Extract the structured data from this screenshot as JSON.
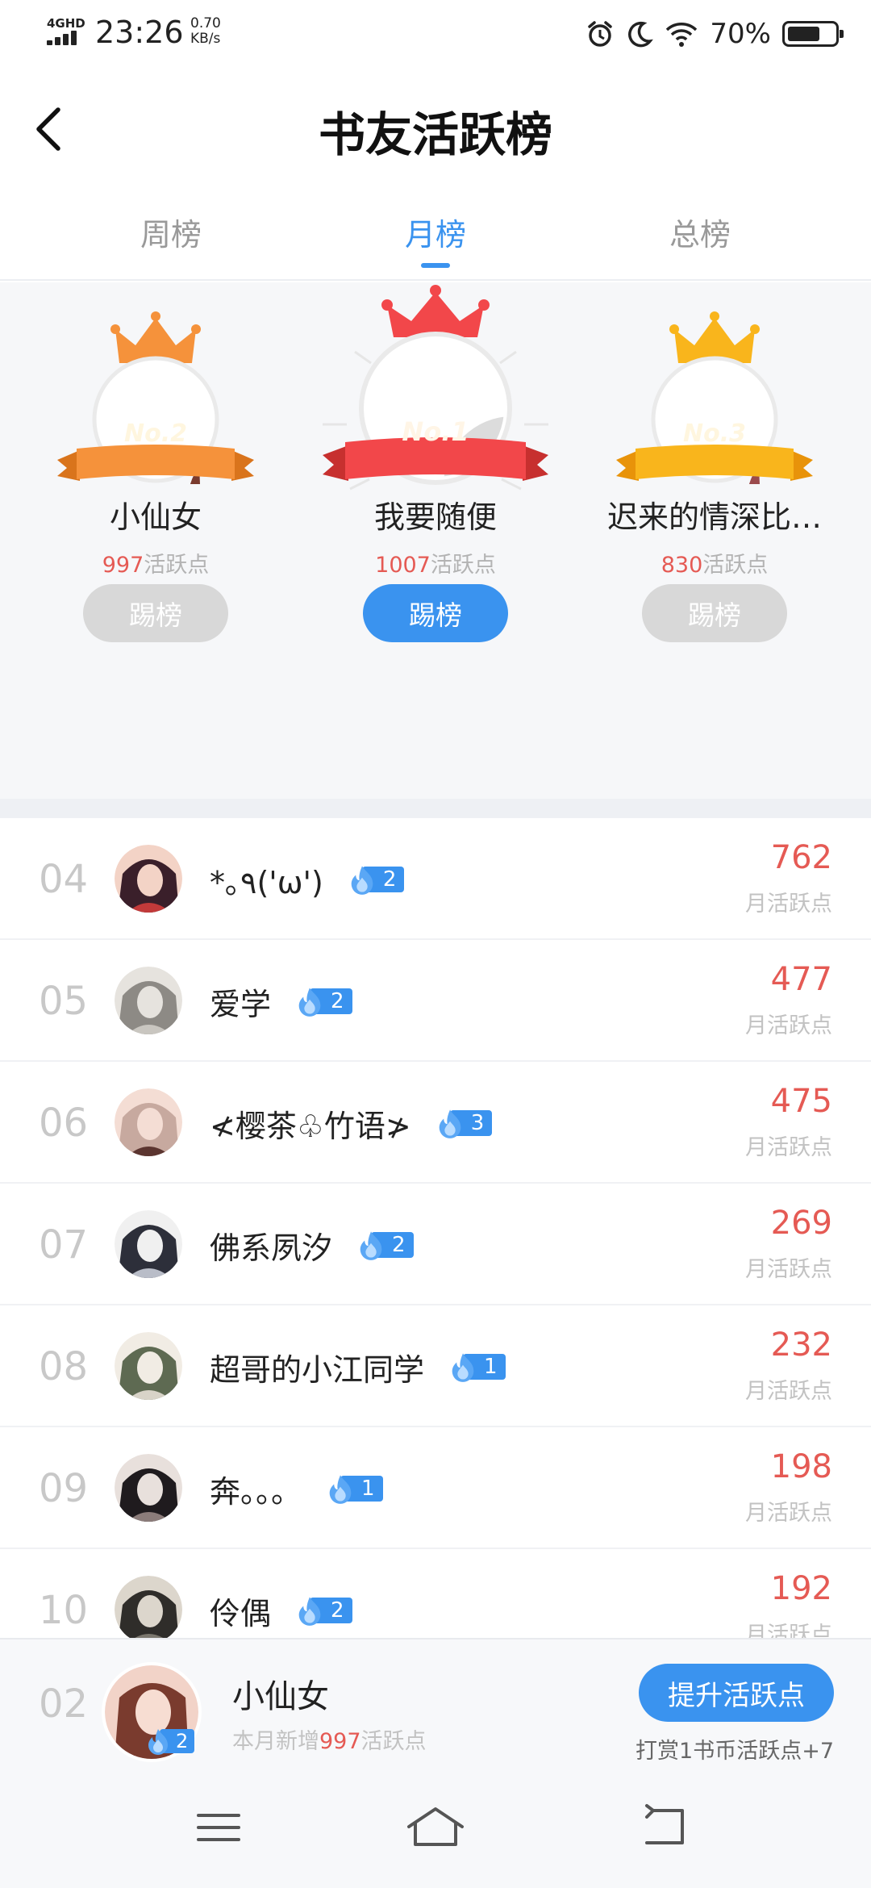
{
  "status_bar": {
    "network": "4GHD",
    "time": "23:26",
    "speed_value": "0.70",
    "speed_unit": "KB/s",
    "battery_text": "70%",
    "battery_level": 0.7
  },
  "header": {
    "title": "书友活跃榜"
  },
  "tabs": [
    {
      "label": "周榜",
      "active": false
    },
    {
      "label": "月榜",
      "active": true
    },
    {
      "label": "总榜",
      "active": false
    }
  ],
  "podium": {
    "second": {
      "badge": "No.2",
      "name": "小仙女",
      "points": "997",
      "points_suffix": "活跃点",
      "button": "踢榜",
      "crown_color": "#f5923b"
    },
    "first": {
      "badge": "No.1",
      "name": "我要随便",
      "points": "1007",
      "points_suffix": "活跃点",
      "button": "踢榜",
      "crown_color": "#f2474a"
    },
    "third": {
      "badge": "No.3",
      "name": "迟来的情深比…",
      "points": "830",
      "points_suffix": "活跃点",
      "button": "踢榜",
      "crown_color": "#f9b51c"
    }
  },
  "ranking": [
    {
      "rank": "04",
      "name": "*｡٩('ω')",
      "level": "2",
      "score": "762",
      "score_label": "月活跃点"
    },
    {
      "rank": "05",
      "name": "爱学",
      "level": "2",
      "score": "477",
      "score_label": "月活跃点"
    },
    {
      "rank": "06",
      "name": "≮樱茶♧竹语≯",
      "level": "3",
      "score": "475",
      "score_label": "月活跃点"
    },
    {
      "rank": "07",
      "name": "佛系夙汐",
      "level": "2",
      "score": "269",
      "score_label": "月活跃点"
    },
    {
      "rank": "08",
      "name": "超哥的小江同学",
      "level": "1",
      "score": "232",
      "score_label": "月活跃点"
    },
    {
      "rank": "09",
      "name": "奔。。。",
      "level": "1",
      "score": "198",
      "score_label": "月活跃点"
    },
    {
      "rank": "10",
      "name": "伶偶",
      "level": "2",
      "score": "192",
      "score_label": "月活跃点"
    }
  ],
  "self": {
    "rank": "02",
    "name": "小仙女",
    "level": "2",
    "sub_prefix": "本月新增",
    "sub_points": "997",
    "sub_suffix": "活跃点",
    "button": "提升活跃点",
    "tip": "打赏1书币活跃点+7"
  },
  "colors": {
    "accent": "#3a93ef",
    "score": "#e55a54",
    "muted": "#c2c2c2"
  }
}
